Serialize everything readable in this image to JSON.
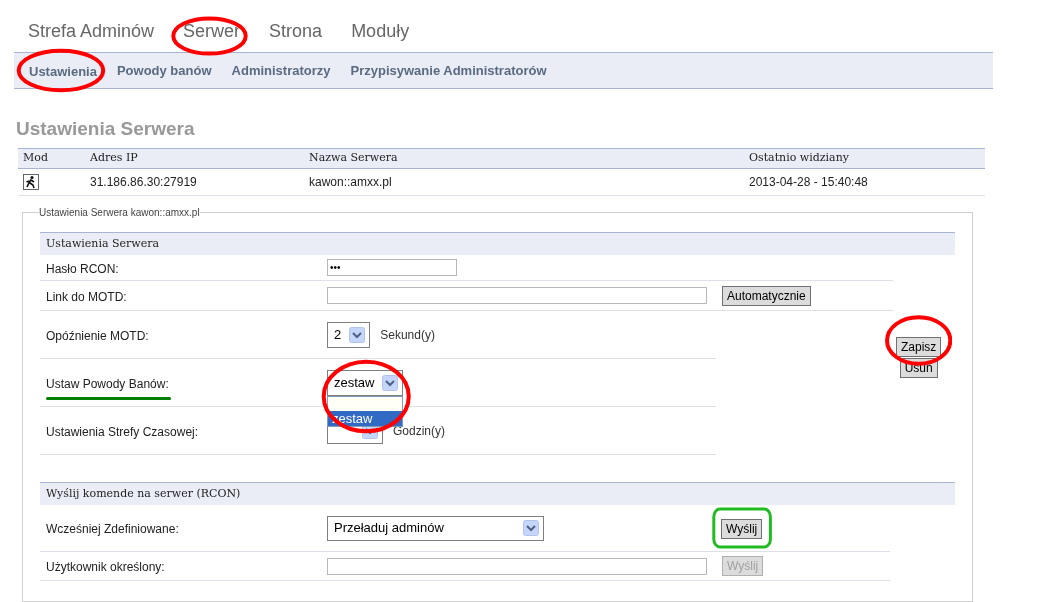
{
  "nav": [
    {
      "label": "Strefa Adminów"
    },
    {
      "label": "Serwer",
      "annotation": {
        "kind": "ellipse",
        "color": "#ff0000"
      }
    },
    {
      "label": "Strona"
    },
    {
      "label": "Moduły"
    }
  ],
  "subnav": [
    {
      "label": "Ustawienia",
      "annotation": {
        "kind": "ellipse",
        "color": "#ff0000"
      }
    },
    {
      "label": "Powody banów"
    },
    {
      "label": "Administratorzy"
    },
    {
      "label": "Przypisywanie Administratorów"
    }
  ],
  "page_title": "Ustawienia Serwera",
  "servers": {
    "columns": [
      "Mod",
      "Adres IP",
      "Nazwa Serwera",
      "Ostatnio widziany"
    ],
    "rows": [
      {
        "ip": "31.186.86.30:27919",
        "name": "kawon::amxx.pl",
        "last_seen": "2013-04-28 - 15:40:48"
      }
    ]
  },
  "settings": {
    "legend": "Ustawienia Serwera kawon::amxx.pl",
    "section": {
      "title": "Ustawienia Serwera",
      "rows": [
        {
          "kind": "password",
          "label": "Hasło RCON:",
          "value": "•••"
        },
        {
          "kind": "text_button",
          "label": "Link do MOTD:",
          "button": {
            "label": "Automatycznie",
            "disabled": false
          }
        },
        {
          "kind": "select",
          "label": "Opóźnienie MOTD:",
          "value": "2",
          "suffix": "Sekund(y)"
        },
        {
          "kind": "select",
          "label": "Ustaw Powody Banów:",
          "value": "zestaw",
          "open": true,
          "label_annotation": {
            "kind": "underline",
            "color": "#008000"
          },
          "annotation": {
            "kind": "ellipse",
            "color": "#ff0000"
          },
          "options": [
            {
              "label": "zestaw",
              "selected": true
            }
          ]
        },
        {
          "kind": "select",
          "label": "Ustawienia Strefy Czasowej:",
          "suffix": "Godzin(y)"
        }
      ],
      "actions": [
        {
          "label": "Zapisz",
          "annotation": {
            "kind": "ellipse",
            "color": "#ff0000"
          }
        },
        {
          "label": "Usuń"
        }
      ]
    },
    "rcon": {
      "title": "Wyślij komende na serwer (RCON)",
      "rows": [
        {
          "kind": "select_button",
          "label": "Wcześniej Zdefiniowane:",
          "value": "Przeładuj adminów",
          "button": {
            "label": "Wyślij",
            "disabled": false,
            "annotation": {
              "kind": "rect",
              "color": "#22bb22"
            }
          }
        },
        {
          "kind": "text_button",
          "label": "Użytkownik określony:",
          "button": {
            "label": "Wyślij",
            "disabled": true
          }
        }
      ]
    }
  }
}
